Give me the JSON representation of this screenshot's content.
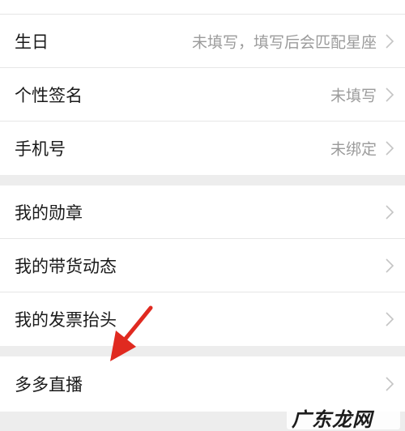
{
  "profile": {
    "rows": [
      {
        "label": "生日",
        "value": "未填写，填写后会匹配星座"
      },
      {
        "label": "个性签名",
        "value": "未填写"
      },
      {
        "label": "手机号",
        "value": "未绑定"
      }
    ]
  },
  "account": {
    "rows": [
      {
        "label": "我的勋章"
      },
      {
        "label": "我的带货动态"
      },
      {
        "label": "我的发票抬头"
      }
    ]
  },
  "live": {
    "rows": [
      {
        "label": "多多直播"
      }
    ]
  },
  "annotation": {
    "arrow_color": "#e02a20"
  },
  "watermark": {
    "text": "广东龙网"
  },
  "icons": {
    "chevron": "chevron-right-icon",
    "arrow": "annotation-arrow-icon"
  }
}
